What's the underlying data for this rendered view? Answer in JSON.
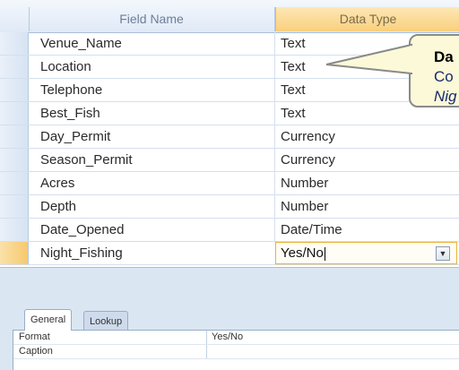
{
  "table": {
    "header": {
      "field_name": "Field Name",
      "data_type": "Data Type"
    },
    "rows": [
      {
        "name": "Venue_Name",
        "type": "Text"
      },
      {
        "name": "Location",
        "type": "Text"
      },
      {
        "name": "Telephone",
        "type": "Text"
      },
      {
        "name": "Best_Fish",
        "type": "Text"
      },
      {
        "name": "Day_Permit",
        "type": "Currency"
      },
      {
        "name": "Season_Permit",
        "type": "Currency"
      },
      {
        "name": "Acres",
        "type": "Number"
      },
      {
        "name": "Depth",
        "type": "Number"
      },
      {
        "name": "Date_Opened",
        "type": "Date/Time"
      },
      {
        "name": "Night_Fishing",
        "type": "Yes/No"
      }
    ],
    "current_row": 9
  },
  "tabs": {
    "general": "General",
    "lookup": "Lookup"
  },
  "properties": [
    {
      "label": "Format",
      "value": "Yes/No"
    },
    {
      "label": "Caption",
      "value": ""
    }
  ],
  "callout": {
    "line1": "Da",
    "line2": "Co",
    "line3": "Nig"
  },
  "colors": {
    "current_row": "#f6c96e",
    "callout_bg": "#fbf9d8",
    "header_selected": "#f9cf7d"
  }
}
